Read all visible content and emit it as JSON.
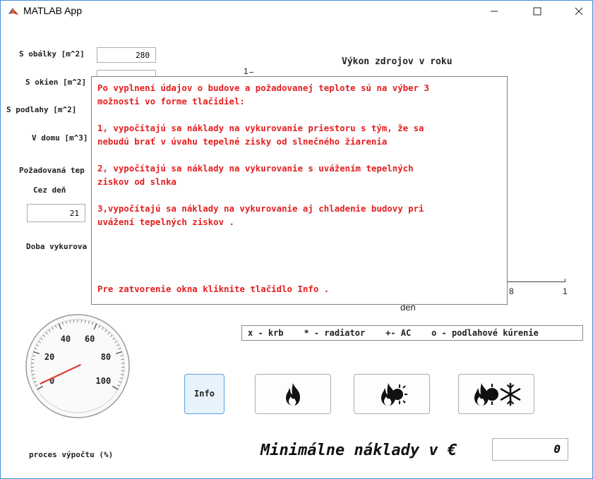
{
  "window": {
    "title": "MATLAB App",
    "minimize_icon": "minimize-icon",
    "maximize_icon": "maximize-icon",
    "close_icon": "close-icon"
  },
  "inputs": {
    "s_obalky": {
      "label": "S obálky [m^2]",
      "value": "280"
    },
    "s_okien": {
      "label": "S okien [m^2]",
      "value": ""
    },
    "s_podlahy": {
      "label": "S podlahy [m^2]"
    },
    "v_domu": {
      "label": "V domu [m^3]"
    },
    "pozadovana_label": "Požadovaná tep",
    "cez_den": {
      "label": "Cez deň",
      "value": "21"
    },
    "doba_label": "Doba vykurova"
  },
  "chart": {
    "title": "Výkon zdrojov v roku",
    "y_tick_top": "1",
    "x_ticks": [
      "8",
      "1"
    ],
    "xlabel": "deň"
  },
  "popup": {
    "lines": [
      "Po vyplnení údajov o budove a požadovanej teplote sú na výber 3",
      "možnosti vo forme tlačidiel:",
      "",
      "1, vypočítajú sa náklady na vykurovanie priestoru s tým, že sa",
      "nebudú brať v úvahu tepelné zisky od slnečného žiarenia",
      "",
      "2, vypočítajú sa náklady na vykurovanie s uvážením tepelných",
      "ziskov od slnka",
      "",
      "3,vypočítajú sa náklady na vykurovanie aj chladenie budovy pri",
      "uvážení tepelných ziskov .",
      "",
      "",
      "",
      "",
      "Pre zatvorenie okna kliknite tlačidlo Info ."
    ]
  },
  "legend": "x - krb    * - radiator    +- AC    o - podlahové kúrenie",
  "gauge": {
    "labels": [
      "0",
      "20",
      "40",
      "60",
      "80",
      "100"
    ],
    "value": 2,
    "caption": "proces výpočtu (%)"
  },
  "buttons": {
    "info": "Info",
    "icons": [
      "fire-icon",
      "fire-sun-icon",
      "fire-sun-snowflake-icon"
    ]
  },
  "result": {
    "label": "Minimálne náklady v €",
    "value": "0"
  },
  "colors": {
    "popup_text": "#e41e1e",
    "gauge_needle": "#e23c2e",
    "window_border": "#4a90d9"
  }
}
